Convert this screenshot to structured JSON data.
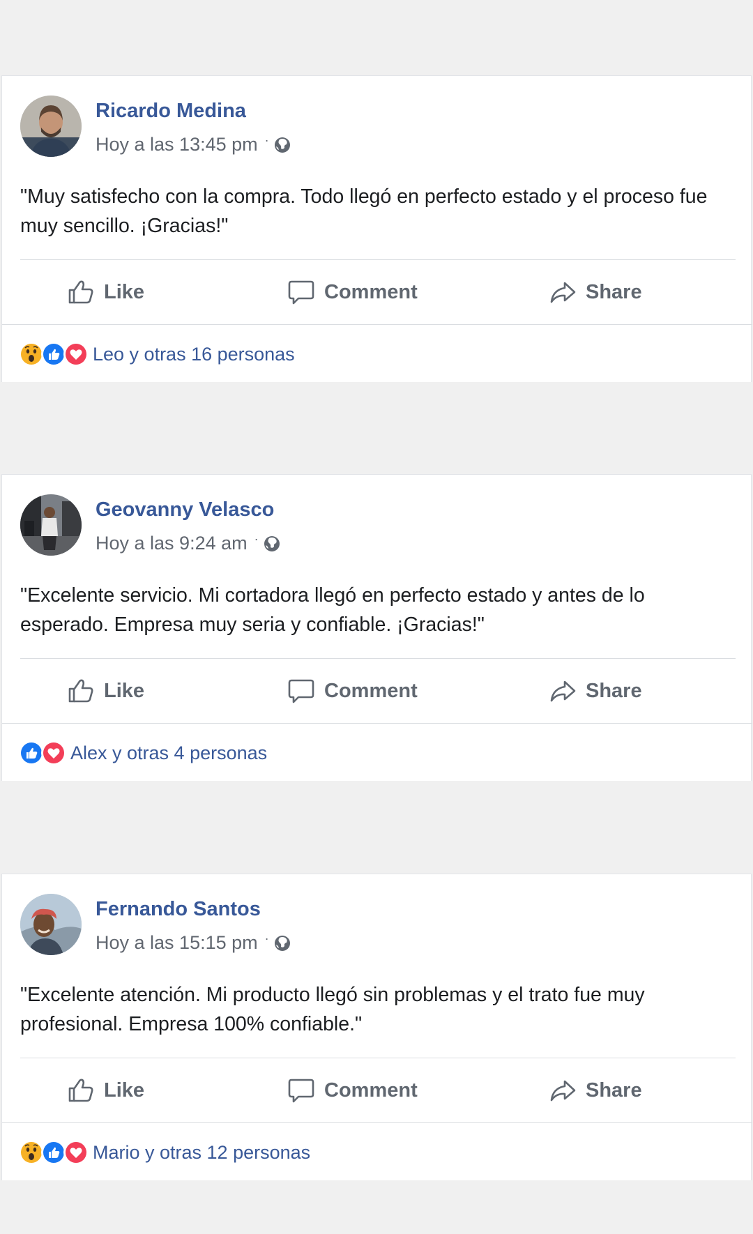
{
  "posts": [
    {
      "author": "Ricardo Medina",
      "time": "Hoy a las 13:45 pm",
      "separator": "·",
      "text": "\"Muy satisfecho con la compra. Todo llegó en perfecto estado y el proceso fue muy sencillo. ¡Gracias!\"",
      "reactions": [
        "wow",
        "like",
        "love"
      ],
      "reaction_text": "Leo y otras 16 personas"
    },
    {
      "author": "Geovanny Velasco",
      "time": "Hoy a las 9:24 am",
      "separator": "·",
      "text": "\"Excelente servicio. Mi cortadora llegó en perfecto estado y antes de lo esperado. Empresa muy seria y confiable. ¡Gracias!\"",
      "reactions": [
        "like",
        "love"
      ],
      "reaction_text": "Alex y otras 4 personas"
    },
    {
      "author": "Fernando Santos",
      "time": "Hoy a las 15:15 pm",
      "separator": "·",
      "text": "\"Excelente atención. Mi producto llegó sin problemas y el trato fue muy profesional. Empresa 100% confiable.\"",
      "reactions": [
        "wow",
        "like",
        "love"
      ],
      "reaction_text": "Mario y otras 12 personas"
    }
  ],
  "actions": {
    "like": "Like",
    "comment": "Comment",
    "share": "Share"
  },
  "icons": {
    "like": "thumbs-up-outline-icon",
    "comment": "speech-bubble-icon",
    "share": "share-arrow-icon",
    "privacy": "globe-icon",
    "reaction_like": "like-reaction-icon",
    "reaction_love": "heart-reaction-icon",
    "reaction_wow": "wow-reaction-icon"
  },
  "colors": {
    "author": "#385898",
    "link": "#385898",
    "meta": "#616770",
    "body": "#1c1e21",
    "action": "#606770",
    "like_blue": "#1877f2",
    "love_red": "#f33e58",
    "wow_yellow": "#f7b125",
    "background": "#f0f0f0"
  }
}
